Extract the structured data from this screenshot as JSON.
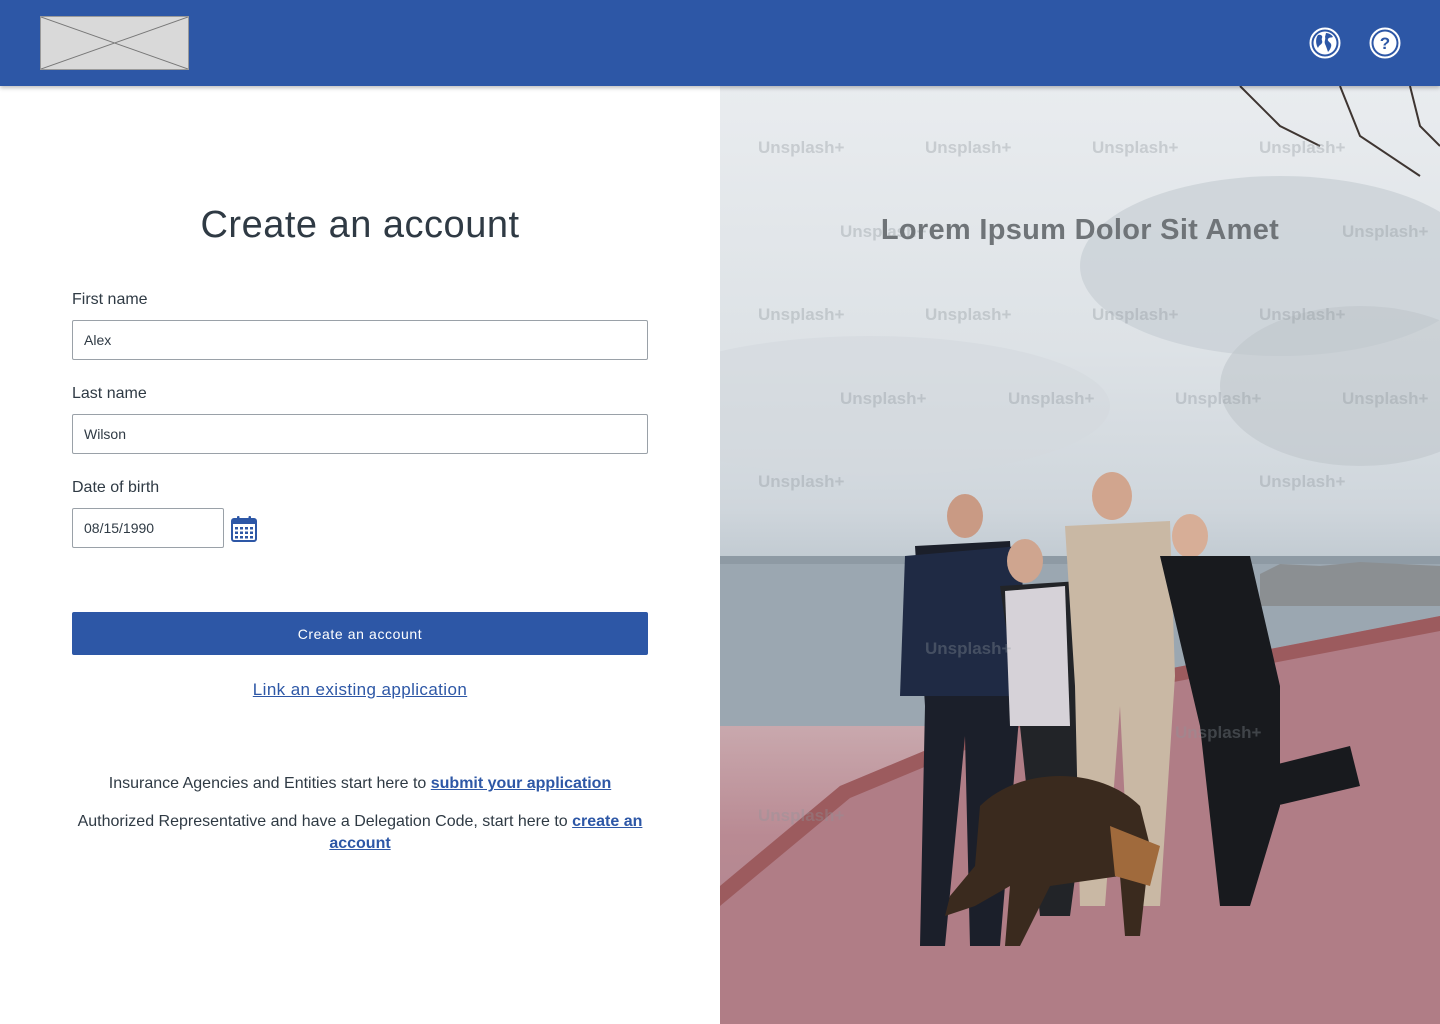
{
  "header": {
    "logo_icon": "image-placeholder-icon",
    "globe_icon": "globe-icon",
    "help_icon": "help-icon",
    "help_glyph": "?",
    "bar_color": "#2d57a6"
  },
  "form": {
    "title": "Create an account",
    "first_name": {
      "label": "First name",
      "value": "Alex"
    },
    "last_name": {
      "label": "Last name",
      "value": "Wilson"
    },
    "dob": {
      "label": "Date of birth",
      "value": "08/15/1990",
      "icon": "calendar-icon"
    },
    "submit_label": "Create an account",
    "link_existing": "Link an existing application",
    "agencies": {
      "text": "Insurance Agencies and Entities start here to ",
      "link": "submit your application"
    },
    "representative": {
      "text": "Authorized Representative and have a Delegation Code, start here to ",
      "link": "create an account"
    }
  },
  "hero": {
    "title": "Lorem Ipsum Dolor Sit Amet",
    "watermark": "Unsplash+"
  }
}
